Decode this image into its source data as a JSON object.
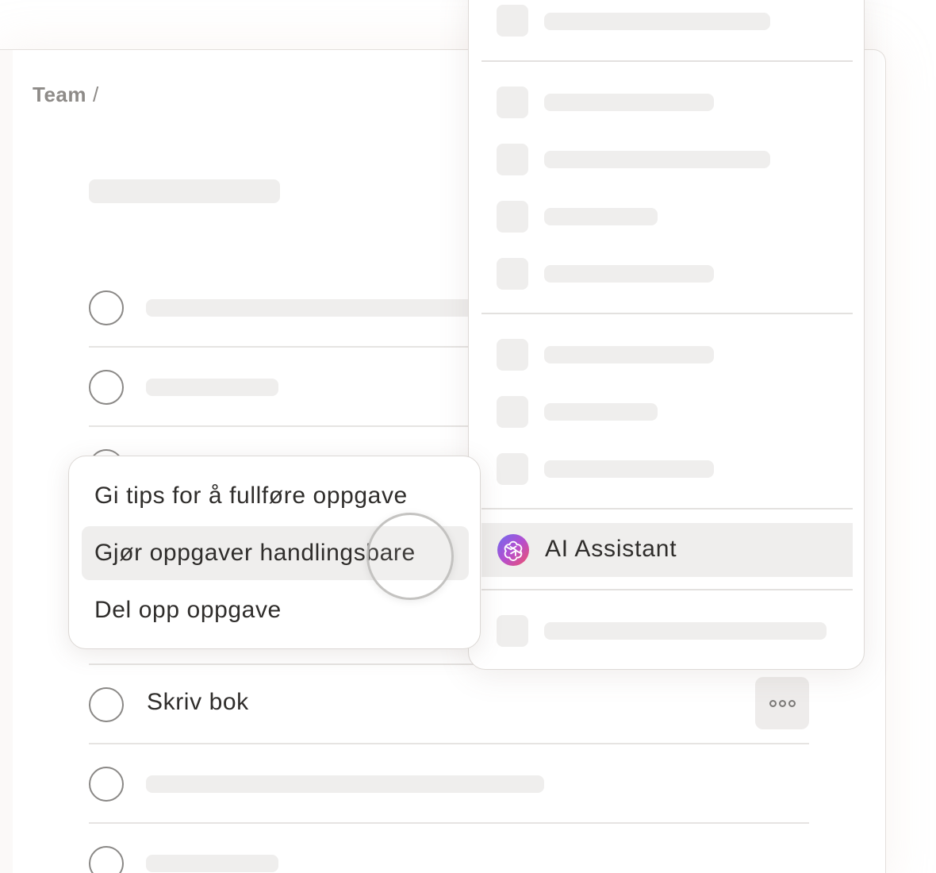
{
  "breadcrumb": {
    "label": "Team",
    "separator": "/"
  },
  "tasks": [
    {
      "checked": false,
      "text": ""
    },
    {
      "checked": false,
      "text": ""
    },
    {
      "checked": false,
      "text": ""
    },
    {
      "checked": false,
      "text": ""
    },
    {
      "checked": false,
      "text": "Skriv bok"
    },
    {
      "checked": false,
      "text": ""
    },
    {
      "checked": false,
      "text": ""
    }
  ],
  "task_actions": {
    "more_icon": "more-horizontal-icon"
  },
  "context_menu": {
    "items": [
      {
        "label": "Gi tips for å fullføre oppgave",
        "highlighted": false
      },
      {
        "label": "Gjør oppgaver handlingsbare",
        "highlighted": true
      },
      {
        "label": "Del opp oppgave",
        "highlighted": false
      }
    ]
  },
  "dropdown": {
    "ai_item": {
      "label": "AI Assistant",
      "icon": "openai-logo-icon",
      "highlighted": true
    }
  },
  "colors": {
    "skeleton": "#efeeed",
    "highlight": "#efeeed",
    "text": "#2f2d2b",
    "muted": "#8e8b88"
  }
}
